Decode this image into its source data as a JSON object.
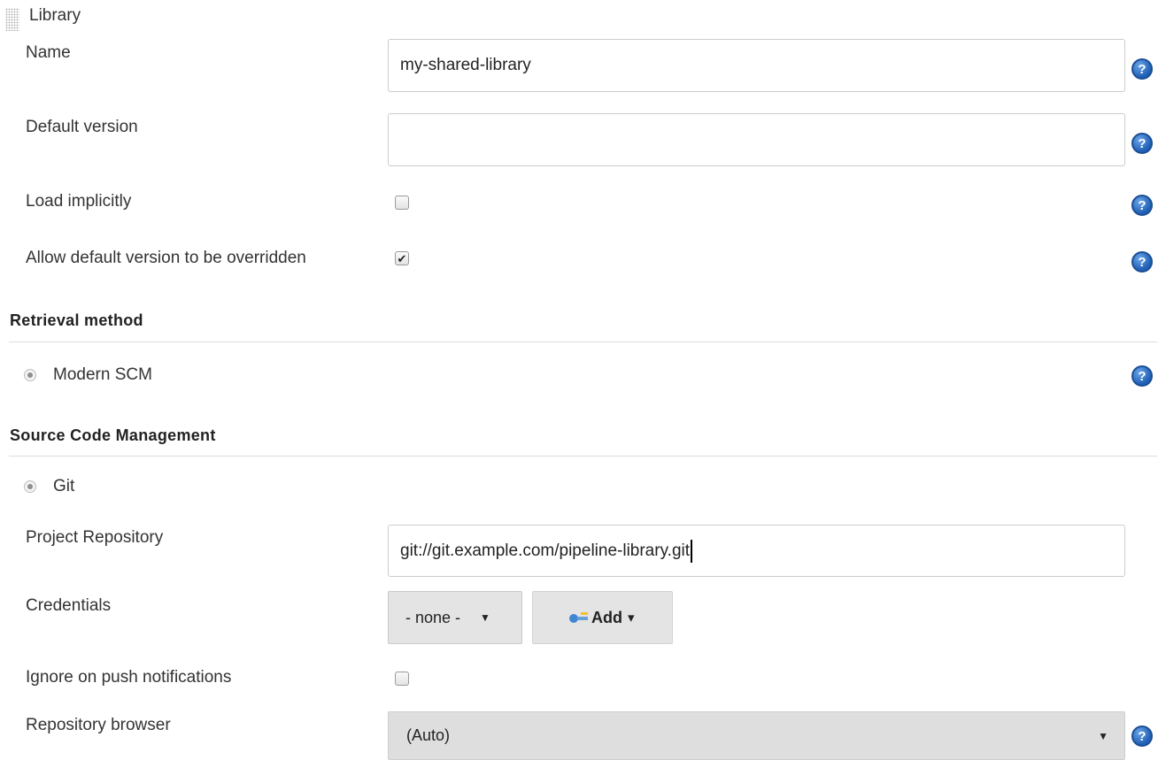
{
  "header": {
    "title": "Library"
  },
  "fields": {
    "name": {
      "label": "Name",
      "value": "my-shared-library"
    },
    "default_version": {
      "label": "Default version",
      "value": ""
    },
    "load_implicitly": {
      "label": "Load implicitly",
      "checked": false
    },
    "allow_override": {
      "label": "Allow default version to be overridden",
      "checked": true
    }
  },
  "retrieval": {
    "title": "Retrieval method",
    "option": "Modern SCM"
  },
  "scm": {
    "title": "Source Code Management",
    "option": "Git",
    "project_repository": {
      "label": "Project Repository",
      "value": "git://git.example.com/pipeline-library.git"
    },
    "credentials": {
      "label": "Credentials",
      "selected": "- none -",
      "add_label": "Add"
    },
    "ignore_push": {
      "label": "Ignore on push notifications",
      "checked": false
    },
    "repo_browser": {
      "label": "Repository browser",
      "selected": "(Auto)"
    }
  },
  "icons": {
    "help": "?",
    "check": "✔",
    "dropdown": "▼",
    "add_caret": "▾"
  },
  "colors": {
    "help_blue": "#1f5fb5",
    "button_gray": "#e4e4e4",
    "select_gray": "#dedede"
  }
}
